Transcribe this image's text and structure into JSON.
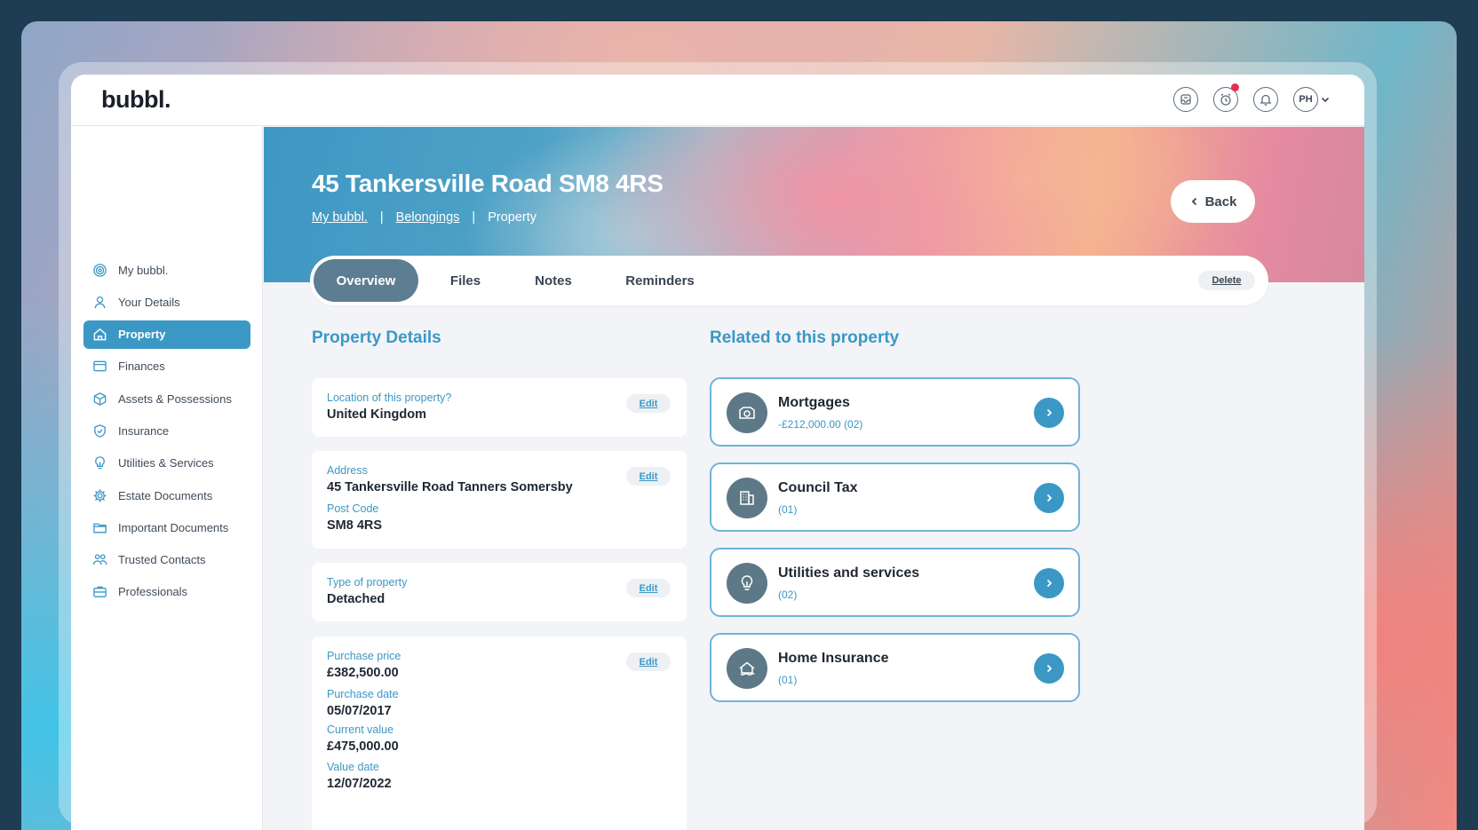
{
  "app": {
    "logo": "bubbl."
  },
  "header": {
    "avatar_initials": "PH"
  },
  "sidebar": {
    "items": [
      {
        "label": "My bubbl.",
        "icon": "target-icon",
        "active": false
      },
      {
        "label": "Your Details",
        "icon": "user-icon",
        "active": false
      },
      {
        "label": "Property",
        "icon": "home-icon",
        "active": true
      },
      {
        "label": "Finances",
        "icon": "wallet-icon",
        "active": false
      },
      {
        "label": "Assets & Possessions",
        "icon": "box-icon",
        "active": false
      },
      {
        "label": "Insurance",
        "icon": "shield-icon",
        "active": false
      },
      {
        "label": "Utilities & Services",
        "icon": "lightbulb-icon",
        "active": false
      },
      {
        "label": "Estate Documents",
        "icon": "gear-icon",
        "active": false
      },
      {
        "label": "Important Documents",
        "icon": "folder-icon",
        "active": false
      },
      {
        "label": "Trusted Contacts",
        "icon": "people-icon",
        "active": false
      },
      {
        "label": "Professionals",
        "icon": "briefcase-icon",
        "active": false
      }
    ]
  },
  "hero": {
    "title": "45 Tankersville Road SM8 4RS",
    "breadcrumb": [
      "My bubbl.",
      "Belongings",
      "Property"
    ],
    "back_label": "Back"
  },
  "tabs": {
    "items": [
      "Overview",
      "Files",
      "Notes",
      "Reminders"
    ],
    "active": "Overview",
    "delete_label": "Delete"
  },
  "details": {
    "title": "Property Details",
    "edit_label": "Edit",
    "location": {
      "label": "Location of this property?",
      "value": "United Kingdom"
    },
    "address": {
      "label": "Address",
      "value": "45 Tankersville Road Tanners Somersby",
      "postcode_label": "Post Code",
      "postcode_value": "SM8 4RS"
    },
    "type": {
      "label": "Type of property",
      "value": "Detached"
    },
    "purchase": {
      "price_label": "Purchase price",
      "price_value": "£382,500.00",
      "date_label": "Purchase date",
      "date_value": "05/07/2017",
      "current_label": "Current value",
      "current_value": "£475,000.00",
      "value_date_label": "Value date",
      "value_date_value": "12/07/2022"
    }
  },
  "related": {
    "title": "Related to this property",
    "items": [
      {
        "title": "Mortgages",
        "sub": "-£212,000.00   (02)",
        "icon": "camera-icon"
      },
      {
        "title": "Council Tax",
        "sub": "(01)",
        "icon": "building-icon"
      },
      {
        "title": "Utilities and services",
        "sub": "(02)",
        "icon": "lightbulb-icon"
      },
      {
        "title": "Home Insurance",
        "sub": "(01)",
        "icon": "home-shield-icon"
      }
    ]
  },
  "colors": {
    "accent": "#3b98c5",
    "tab_active": "#5d7d92",
    "text": "#1f2733"
  }
}
